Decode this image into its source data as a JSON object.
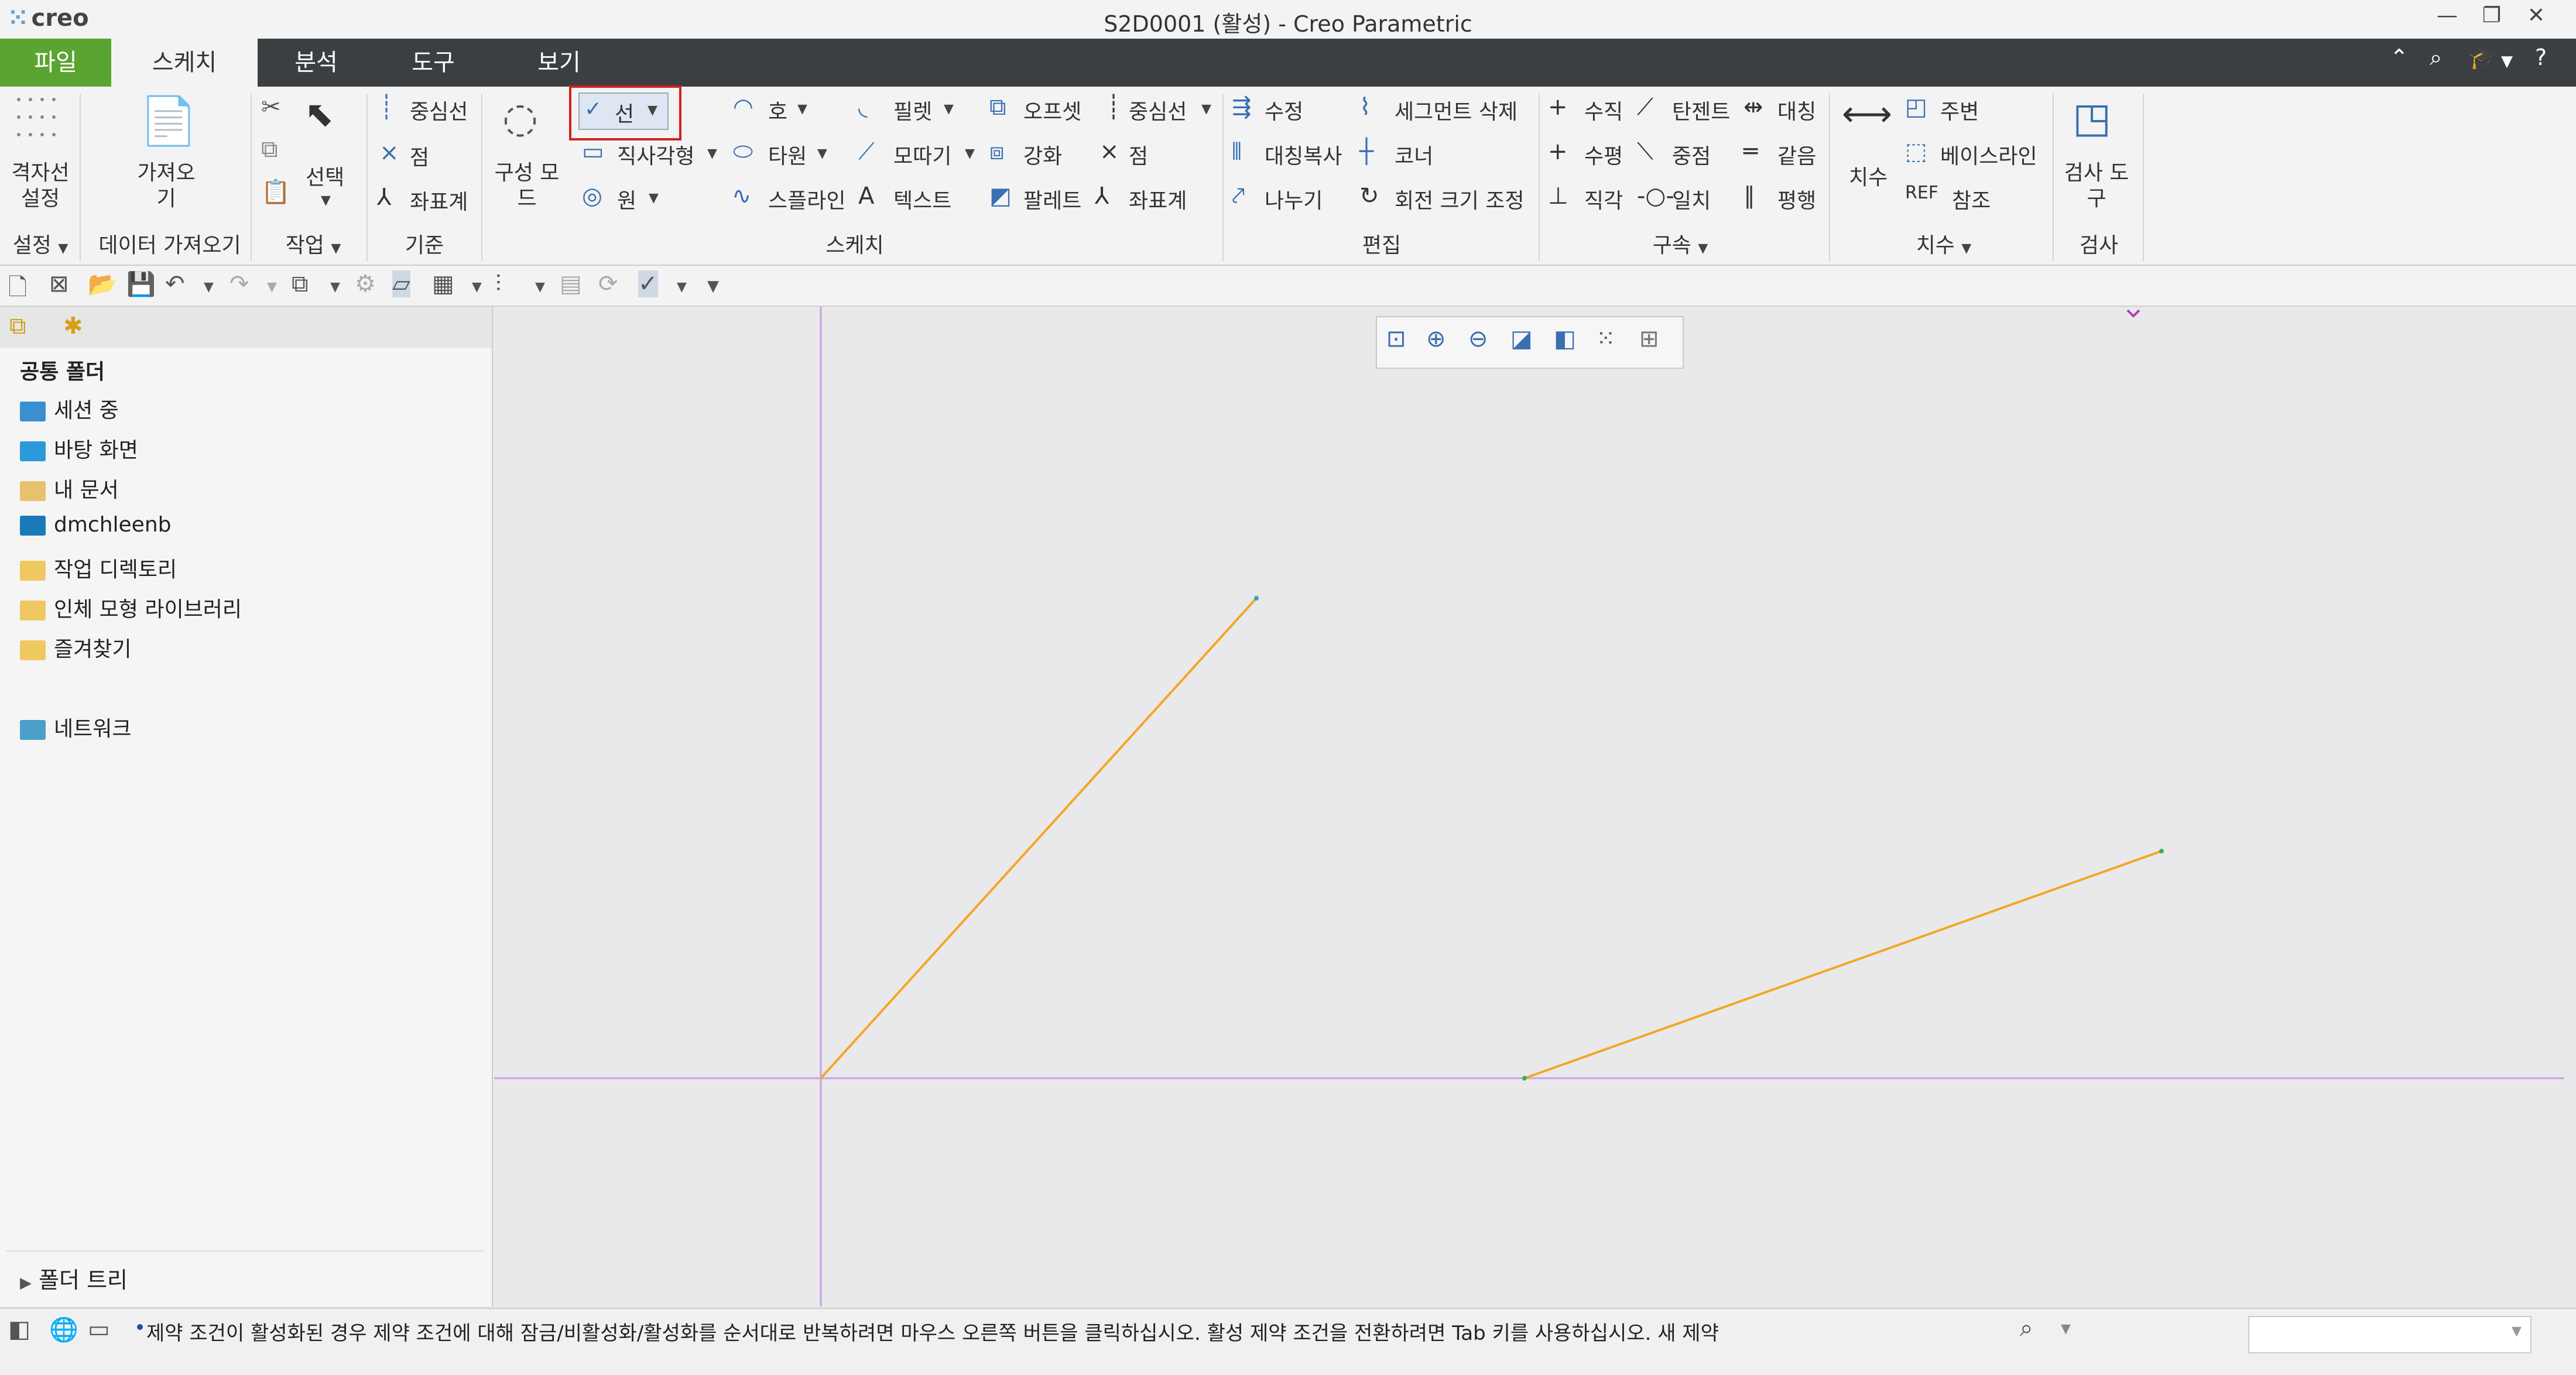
{
  "app": {
    "logo": "creo",
    "window_title": "S2D0001 (활성) - Creo Parametric"
  },
  "menu": {
    "tabs": [
      "파일",
      "스케치",
      "분석",
      "도구",
      "보기"
    ]
  },
  "ribbon": {
    "setup": {
      "grid": "격자선\n설정",
      "label": "설정"
    },
    "import": {
      "get": "가져오\n기",
      "label": "데이터 가져오기"
    },
    "ops": {
      "select": "선택",
      "label": "작업"
    },
    "datum": {
      "centerline": "중심선",
      "point": "점",
      "coord": "좌표계",
      "label": "기준"
    },
    "construct": {
      "mode": "구성 모\n드"
    },
    "sketch": {
      "line": "선",
      "rect": "직사각형",
      "circle": "원",
      "arc": "호",
      "ellipse": "타원",
      "spline": "스플라인",
      "fillet": "필렛",
      "chamfer": "모따기",
      "text": "텍스트",
      "offset": "오프셋",
      "thicken": "강화",
      "palette": "팔레트",
      "centerline": "중심선",
      "point": "점",
      "coord": "좌표계",
      "label": "스케치"
    },
    "edit": {
      "modify": "수정",
      "mirror": "대칭복사",
      "divide": "나누기",
      "delete_segment": "세그먼트 삭제",
      "corner": "코너",
      "rotate_resize": "회전 크기 조정",
      "label": "편집"
    },
    "constrain": {
      "vertical": "수직",
      "horizontal": "수평",
      "perpendicular": "직각",
      "tangent": "탄젠트",
      "midpoint": "중점",
      "coincident": "일치",
      "symmetric": "대칭",
      "equal": "같음",
      "parallel": "평행",
      "label": "구속"
    },
    "dimension": {
      "dim": "치수",
      "perimeter": "주변",
      "baseline": "베이스라인",
      "reference": "참조",
      "label": "치수"
    },
    "inspect": {
      "tools": "검사 도\n구",
      "label": "검사"
    }
  },
  "left_panel": {
    "common_folders": "공통 폴더",
    "items": [
      "세션 중",
      "바탕 화면",
      "내 문서",
      "dmchleenb",
      "작업 디렉토리",
      "인체 모형 라이브러리",
      "즐겨찾기"
    ],
    "network": "네트워크",
    "folder_tree": "폴더 트리"
  },
  "status": {
    "message": "제약 조건이 활성화된 경우 제약 조건에 대해 잠금/비활성화/활성화를 순서대로 반복하려면 마우스 오른쪽 버튼을 클릭하십시오. 활성 제약 조건을 전환하려면 Tab 키를 사용하십시오. 새 제약"
  },
  "colors": {
    "accent_green": "#5aa531",
    "menubar_bg": "#3b3f42",
    "sketch_line": "#f5a623",
    "axis_line": "#c8a0e0",
    "highlight": "#d42020"
  },
  "sketch_entities": [
    {
      "type": "line",
      "label": "line-1"
    },
    {
      "type": "line",
      "label": "line-2"
    }
  ]
}
